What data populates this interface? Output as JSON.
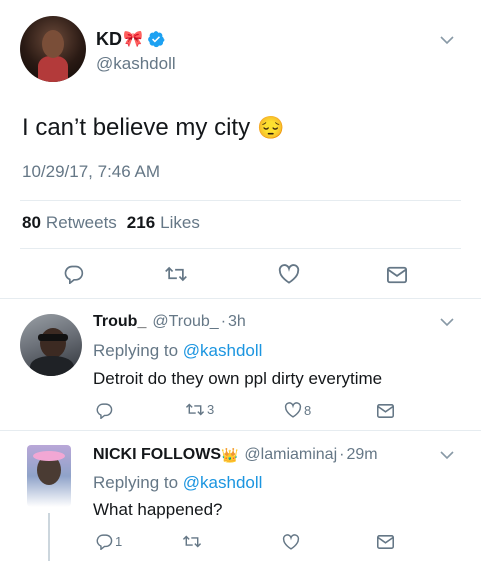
{
  "tweet": {
    "display_name": "KD",
    "name_emoji": "🎀",
    "handle": "@kashdoll",
    "text": "I can’t believe my city",
    "text_emoji": "😔",
    "timestamp": "10/29/17, 7:46 AM",
    "retweets_count": "80",
    "retweets_label": "Retweets",
    "likes_count": "216",
    "likes_label": "Likes"
  },
  "replies": [
    {
      "name": "Troub_",
      "handle": "@Troub_",
      "sep": "·",
      "time": "3h",
      "replying_prefix": "Replying to",
      "replying_handle": "@kashdoll",
      "text": "Detroit do they own ppl dirty everytime",
      "reply_count": "",
      "retweet_count": "3",
      "like_count": "8"
    },
    {
      "name": "NICKI FOLLOWS",
      "name_emoji": "👑",
      "handle": "@lamiaminaj",
      "sep": "·",
      "time": "29m",
      "replying_prefix": "Replying to",
      "replying_handle": "@kashdoll",
      "text": "What happened?",
      "reply_count": "1",
      "retweet_count": "",
      "like_count": ""
    }
  ],
  "colors": {
    "text": "#14171a",
    "muted": "#657786",
    "link": "#1b95e0",
    "verified": "#1da1f2",
    "divider": "#e6ecf0"
  }
}
